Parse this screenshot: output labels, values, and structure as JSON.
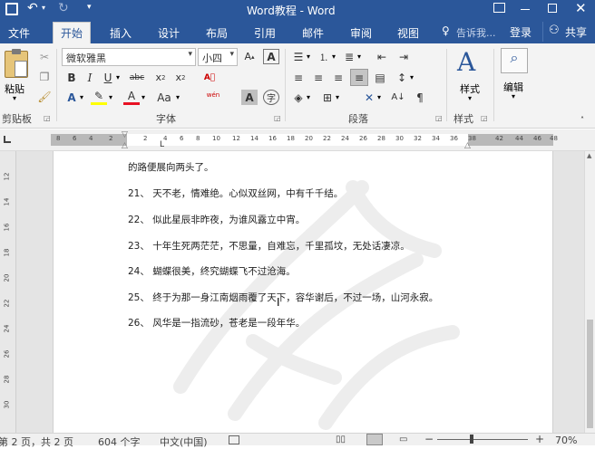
{
  "title": "Word教程 - Word",
  "tabs": [
    "文件",
    "开始",
    "插入",
    "设计",
    "布局",
    "引用",
    "邮件",
    "审阅",
    "视图"
  ],
  "tell_me": "告诉我...",
  "login": "登录",
  "share": "共享",
  "clipboard": {
    "paste": "粘贴",
    "group": "剪贴板"
  },
  "font": {
    "name": "微软雅黑",
    "size": "小四",
    "group": "字体",
    "change_case": "Aa",
    "phonetic": "wén",
    "enclose": "字",
    "shade": "A"
  },
  "paragraph": {
    "group": "段落"
  },
  "styles": {
    "label": "样式",
    "group": "样式"
  },
  "editing": {
    "label": "编辑"
  },
  "ruler_numbers": [
    "8",
    "6",
    "4",
    "2",
    "2",
    "4",
    "6",
    "8",
    "10",
    "12",
    "14",
    "16",
    "18",
    "20",
    "22",
    "24",
    "26",
    "28",
    "30",
    "32",
    "34",
    "36",
    "38",
    "42",
    "44",
    "46",
    "48"
  ],
  "left_ruler_numbers": [
    "12",
    "14",
    "16",
    "18",
    "20",
    "22",
    "24",
    "26",
    "28",
    "30"
  ],
  "doc_lines": [
    "的路便展向两头了。",
    "21、 天不老，情难绝。心似双丝网，中有千千结。",
    "22、 似此星辰非昨夜，为谁风露立中宵。",
    "23、 十年生死两茫茫，不思量，自难忘，千里孤坟，无处话凄凉。",
    "24、 蝴蝶很美，终究蝴蝶飞不过沧海。",
    "25、 终于为那一身江南烟雨覆了天下，容华谢后，不过一场，山河永寂。",
    "26、 风华是一指流砂，苍老是一段年华。"
  ],
  "status": {
    "page": "第 2 页，共 2 页",
    "words": "604 个字",
    "language": "中文(中国)",
    "zoom": "70%"
  },
  "colors": {
    "accent": "#2b579a",
    "highlight": "#ffff00",
    "font_color": "#e81123"
  }
}
